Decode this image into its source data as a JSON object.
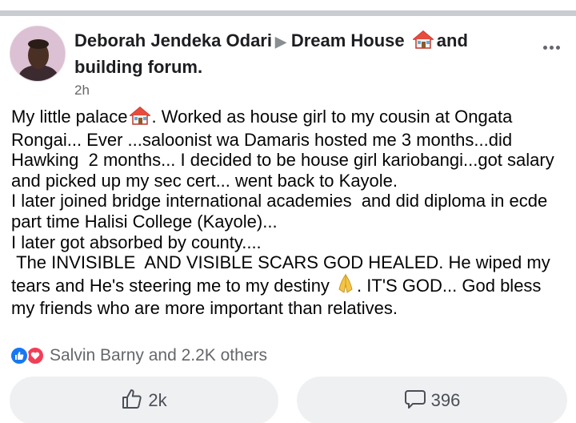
{
  "post": {
    "author": "Deborah Jendeka Odari",
    "group_name": "Dream  House",
    "group_suffix": "and building forum.",
    "time": "2h",
    "body_lines": [
      "My little palace",
      ". Worked as house girl to my cousin at Ongata Rongai... Ever ...saloonist wa Damaris hosted me 3 months...did Hawking  2 months... I decided to be house girl kariobangi...got salary and picked up my sec cert... went back to Kayole.",
      "I later joined bridge international academies  and did diploma in ecde part time Halisi College (Kayole)...",
      "I later got absorbed by county....",
      " The INVISIBLE  AND VISIBLE SCARS GOD HEALED. He wiped my tears and He's steering me to my destiny ",
      ". IT'S GOD... God bless my friends who are more important than relatives."
    ]
  },
  "reactions": {
    "text": "Salvin Barny and 2.2K others",
    "like_color": "#1877f2",
    "love_color": "#f33e58"
  },
  "actions": {
    "like_count": "2k",
    "comment_count": "396"
  }
}
